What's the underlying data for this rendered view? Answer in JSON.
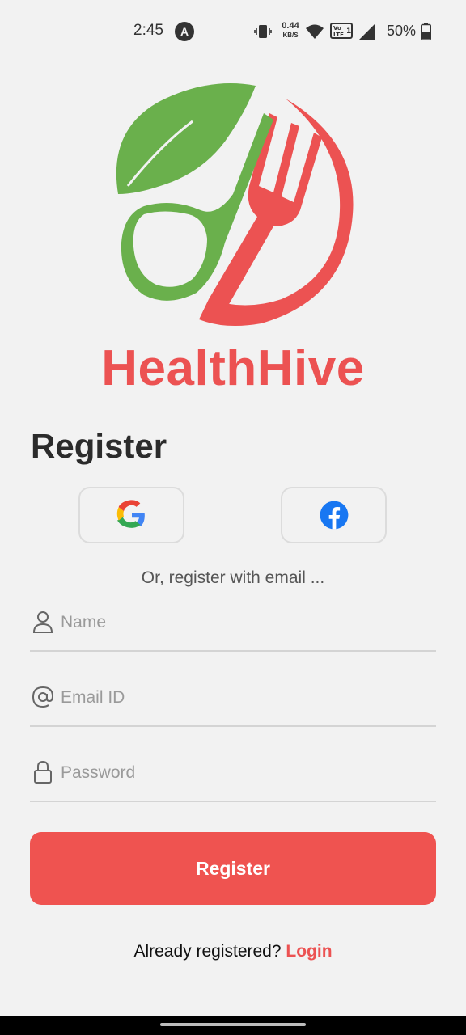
{
  "status_bar": {
    "time": "2:45",
    "app_icon": "A",
    "net_speed": "0.44",
    "net_unit": "KB/S",
    "volte": "Vo LTE 1",
    "battery": "50%",
    "icons": [
      "vibrate-icon",
      "wifi-icon",
      "volte-icon",
      "signal-icon",
      "battery-icon"
    ]
  },
  "brand": {
    "name": "HealthHive",
    "colors": {
      "green": "#6ab04c",
      "red": "#ec5252"
    }
  },
  "page": {
    "title": "Register",
    "social_separator": "Or, register with email ..."
  },
  "social": {
    "google_icon": "google-icon",
    "facebook_icon": "facebook-icon"
  },
  "form": {
    "name": {
      "placeholder": "Name",
      "value": ""
    },
    "email": {
      "placeholder": "Email ID",
      "value": ""
    },
    "password": {
      "placeholder": "Password",
      "value": ""
    },
    "submit_label": "Register"
  },
  "footer": {
    "prompt": "Already registered?",
    "login_label": "Login"
  },
  "colors": {
    "primary": "#ef5350",
    "background": "#f2f2f2"
  }
}
